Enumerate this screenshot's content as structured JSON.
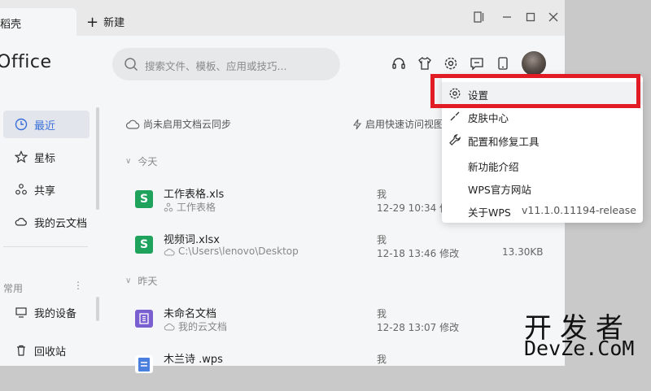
{
  "titlebar": {
    "tab_label": "稻壳",
    "new_tab_label": "新建"
  },
  "app": {
    "logo_text": "Office"
  },
  "search": {
    "placeholder": "搜索文件、模板、应用或技巧..."
  },
  "sidebar": {
    "items": [
      {
        "label": "最近",
        "icon": "clock-icon",
        "active": true
      },
      {
        "label": "星标",
        "icon": "star-icon"
      },
      {
        "label": "共享",
        "icon": "share-icon"
      },
      {
        "label": "我的云文档",
        "icon": "cloud-doc-icon"
      }
    ],
    "section_label": "常用",
    "common_items": [
      {
        "label": "我的设备",
        "icon": "device-icon"
      },
      {
        "label": "回收站",
        "icon": "trash-icon"
      }
    ]
  },
  "main": {
    "sync_label": "尚未启用文档云同步",
    "quick_access_label": "启用快速访问视图",
    "groups": [
      {
        "label": "今天"
      },
      {
        "label": "昨天"
      }
    ],
    "files": [
      {
        "name": "工作表格.xls",
        "location": "工作表格",
        "owner": "我",
        "time": "12-29 10:34 修",
        "size": "",
        "type": "sheet"
      },
      {
        "name": "视频词.xlsx",
        "location": "C:\\Users\\lenovo\\Desktop",
        "owner": "我",
        "time": "12-18 13:46 修改",
        "size": "13.30KB",
        "type": "sheet"
      },
      {
        "name": "未命名文档",
        "location": "我的云文档",
        "owner": "我",
        "time": "12-28 13:07 修改",
        "size": "",
        "type": "form"
      },
      {
        "name": "木兰诗 .wps",
        "location": "",
        "owner": "我",
        "time": "",
        "size": "",
        "type": "doc"
      }
    ]
  },
  "menu": {
    "items": [
      {
        "label": "设置",
        "icon": "gear-icon",
        "highlighted": true
      },
      {
        "label": "皮肤中心",
        "icon": "brush-icon"
      },
      {
        "label": "配置和修复工具",
        "icon": "wrench-icon"
      },
      {
        "label": "新功能介绍"
      },
      {
        "label": "WPS官方网站"
      },
      {
        "label": "关于WPS",
        "value": "v11.1.0.11194-release"
      }
    ]
  },
  "watermark": {
    "line1": "开发者",
    "line2": "DevZe.CoM"
  },
  "colors": {
    "accent": "#3a6fd8",
    "sheet_green": "#1fa35c",
    "form_purple": "#7a5fd1",
    "doc_blue": "#4a7fe0",
    "highlight_red": "#e11c24"
  }
}
